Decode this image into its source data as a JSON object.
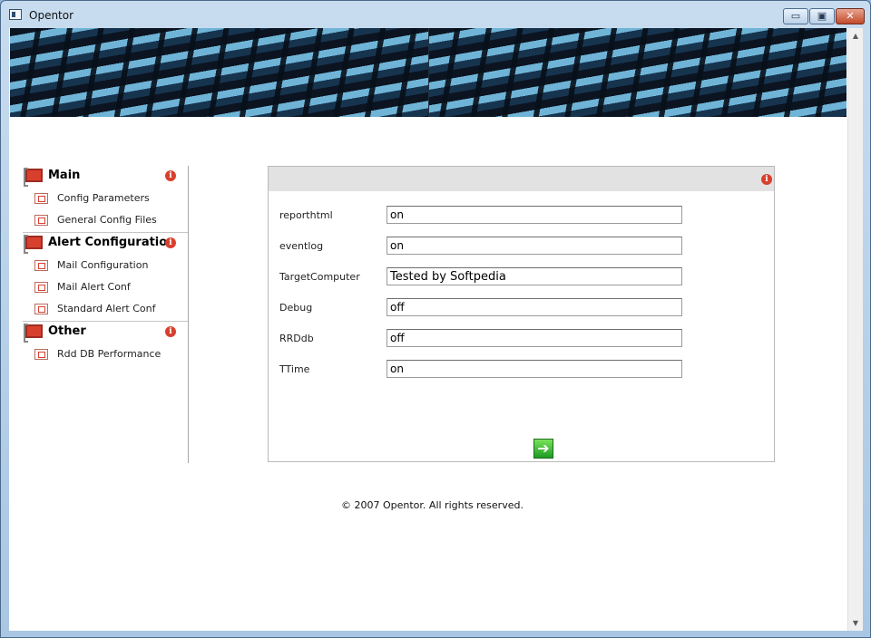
{
  "window": {
    "title": "Opentor",
    "min_label": "▭",
    "max_label": "▣",
    "close_label": "✕"
  },
  "sidebar": {
    "info_symbol": "i",
    "sections": [
      {
        "title": "Main",
        "items": [
          "Config Parameters",
          "General Config Files"
        ]
      },
      {
        "title": "Alert Configuration",
        "items": [
          "Mail Configuration",
          "Mail Alert Conf",
          "Standard Alert Conf"
        ]
      },
      {
        "title": "Other",
        "items": [
          "Rdd DB Performance"
        ]
      }
    ]
  },
  "form": {
    "info_symbol": "i",
    "rows": [
      {
        "label": "reporthtml",
        "value": "on"
      },
      {
        "label": "eventlog",
        "value": "on"
      },
      {
        "label": "TargetComputer",
        "value": "Tested by Softpedia"
      },
      {
        "label": "Debug",
        "value": "off"
      },
      {
        "label": "RRDdb",
        "value": "off"
      },
      {
        "label": "TTime",
        "value": "on"
      }
    ],
    "submit_symbol": "➔"
  },
  "footer": {
    "text": "© 2007 Opentor. All rights reserved."
  },
  "scrollbar": {
    "up": "▲",
    "down": "▼"
  },
  "colors": {
    "accent_red": "#d8402e",
    "panel_header": "#e2e2e2",
    "submit_green": "#1e9b23"
  },
  "icons": {
    "section": "red-box-icon",
    "item": "small-box-icon",
    "info": "info-icon",
    "submit": "arrow-right-icon"
  }
}
